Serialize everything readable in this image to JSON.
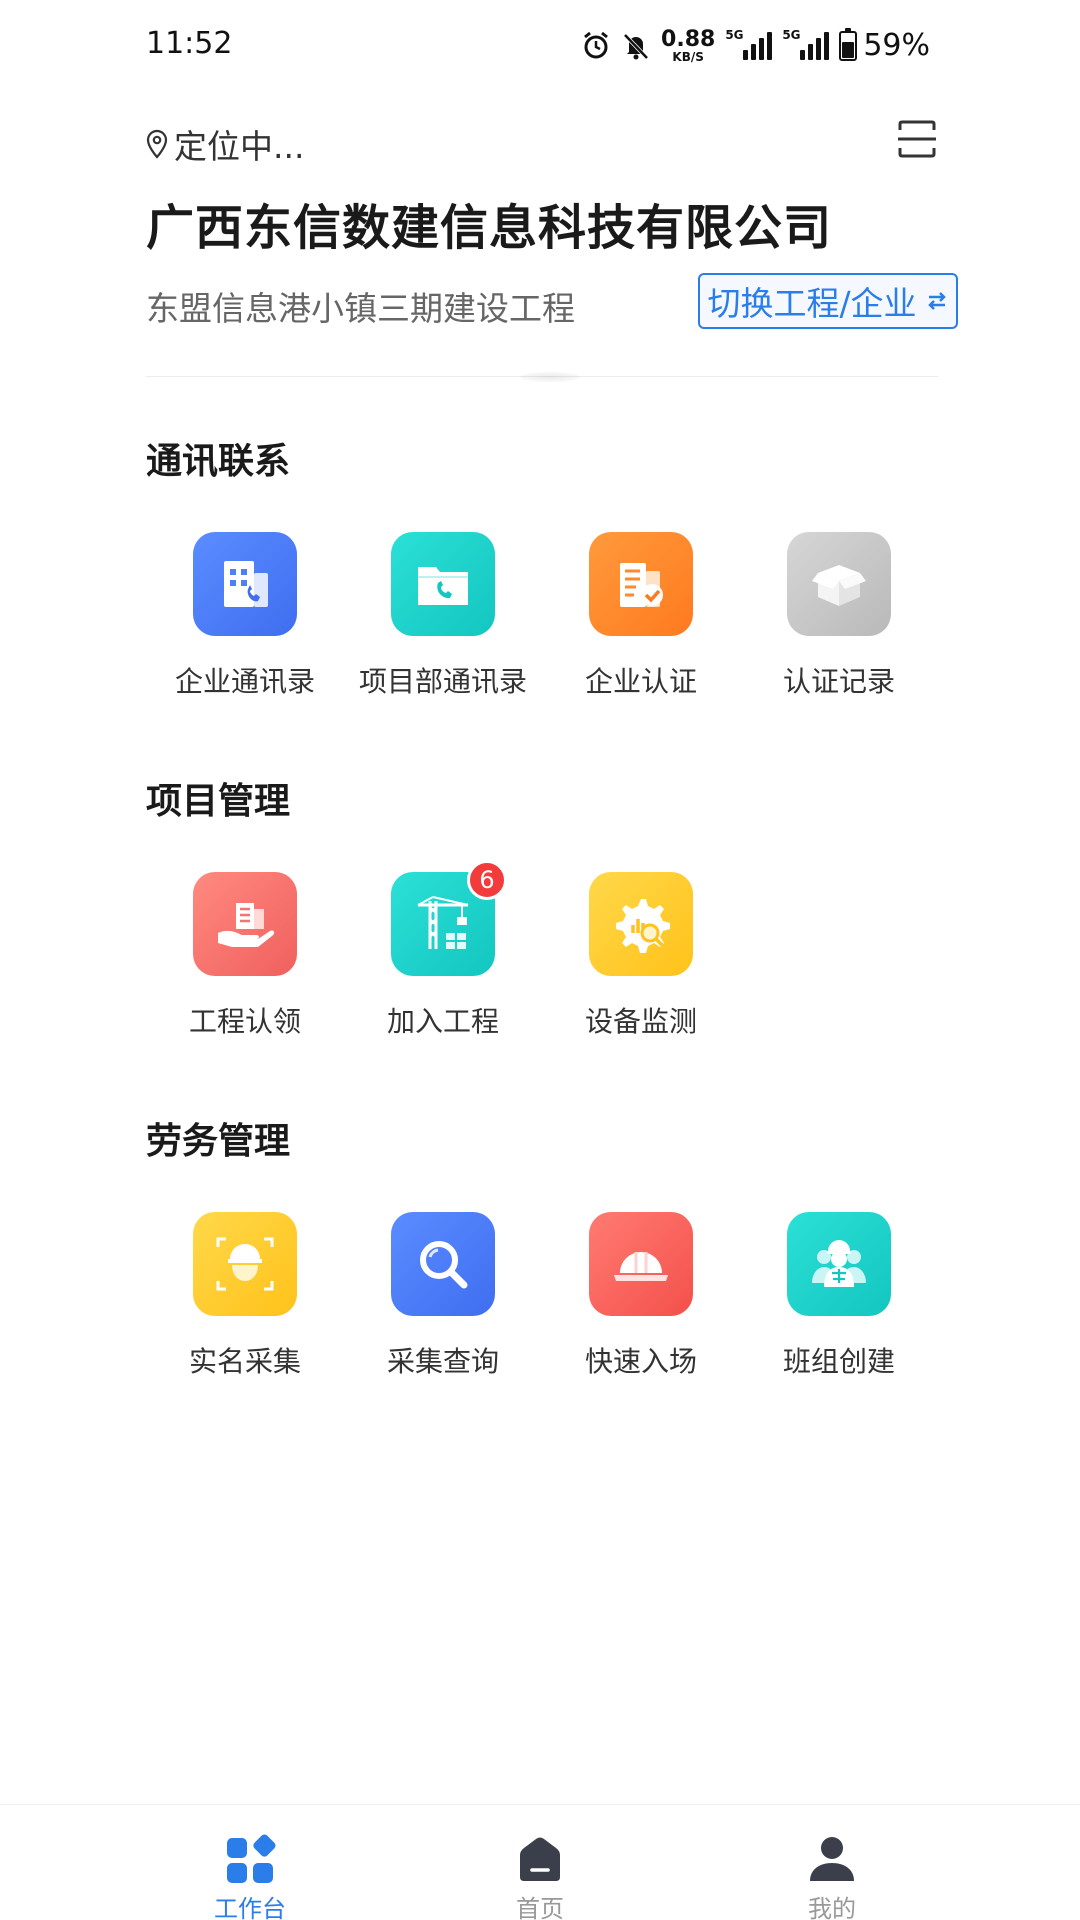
{
  "status": {
    "time": "11:52",
    "net_speed_value": "0.88",
    "net_speed_unit": "KB/S",
    "sim1_tag": "5G",
    "sim2_tag": "5G",
    "battery": "59%",
    "battery_level": 0.59,
    "icons": [
      "alarm-icon",
      "bell-off-icon",
      "signal-icon",
      "battery-icon"
    ]
  },
  "header": {
    "location_text": "定位中...",
    "company": "广西东信数建信息科技有限公司",
    "project": "东盟信息港小镇三期建设工程",
    "switch_label": "切换工程/企业"
  },
  "sections": [
    {
      "title": "通讯联系",
      "items": [
        {
          "label": "企业通讯录",
          "icon": "building-phone-icon",
          "color": "#4f7ff7"
        },
        {
          "label": "项目部通讯录",
          "icon": "folder-phone-icon",
          "color": "#1fd3cc"
        },
        {
          "label": "企业认证",
          "icon": "building-check-icon",
          "color": "#ff8a2e"
        },
        {
          "label": "认证记录",
          "icon": "box-icon",
          "color": "#c8c8c8"
        }
      ]
    },
    {
      "title": "项目管理",
      "items": [
        {
          "label": "工程认领",
          "icon": "hand-building-icon",
          "color": "#f37570"
        },
        {
          "label": "加入工程",
          "icon": "crane-icon",
          "color": "#1fd3cc",
          "badge": "6"
        },
        {
          "label": "设备监测",
          "icon": "gear-search-icon",
          "color": "#ffcd2e"
        }
      ]
    },
    {
      "title": "劳务管理",
      "items": [
        {
          "label": "实名采集",
          "icon": "worker-scan-icon",
          "color": "#ffcd2e"
        },
        {
          "label": "采集查询",
          "icon": "search-icon",
          "color": "#4f7ff7"
        },
        {
          "label": "快速入场",
          "icon": "helmet-icon",
          "color": "#f4605a"
        },
        {
          "label": "班组创建",
          "icon": "team-icon",
          "color": "#1fd3cc"
        }
      ]
    }
  ],
  "nav": {
    "workbench": "工作台",
    "home": "首页",
    "mine": "我的",
    "active": "工作台",
    "active_color": "#2b7de9"
  }
}
